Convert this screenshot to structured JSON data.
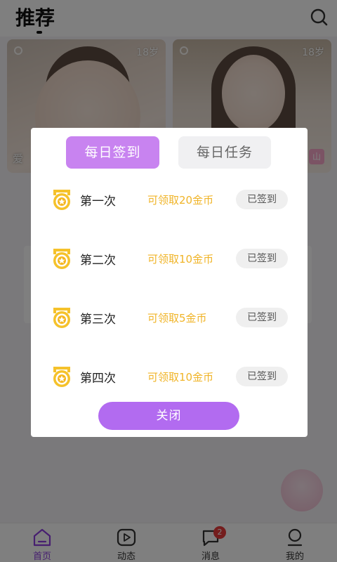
{
  "header": {
    "title": "推荐"
  },
  "cards": [
    {
      "age": "18岁",
      "name": "爱"
    },
    {
      "age": "18岁",
      "badge": "山"
    }
  ],
  "nav": {
    "items": [
      {
        "label": "首页",
        "icon": "home-icon",
        "active": true
      },
      {
        "label": "动态",
        "icon": "feed-play-icon"
      },
      {
        "label": "消息",
        "icon": "message-bubble-icon",
        "badge": "2"
      },
      {
        "label": "我的",
        "icon": "profile-icon"
      }
    ]
  },
  "dialog": {
    "tabs": {
      "checkin": "每日签到",
      "tasks": "每日任务"
    },
    "rows": [
      {
        "label": "第一次",
        "reward": "可领取20金币",
        "status": "已签到"
      },
      {
        "label": "第二次",
        "reward": "可领取10金币",
        "status": "已签到"
      },
      {
        "label": "第三次",
        "reward": "可领取5金币",
        "status": "已签到"
      },
      {
        "label": "第四次",
        "reward": "可领取10金币",
        "status": "已签到"
      }
    ],
    "close_label": "关闭"
  },
  "colors": {
    "accent": "#b26bf0",
    "tab_active": "#c883f0",
    "reward": "#f0b428",
    "badge": "#e83b3b"
  }
}
